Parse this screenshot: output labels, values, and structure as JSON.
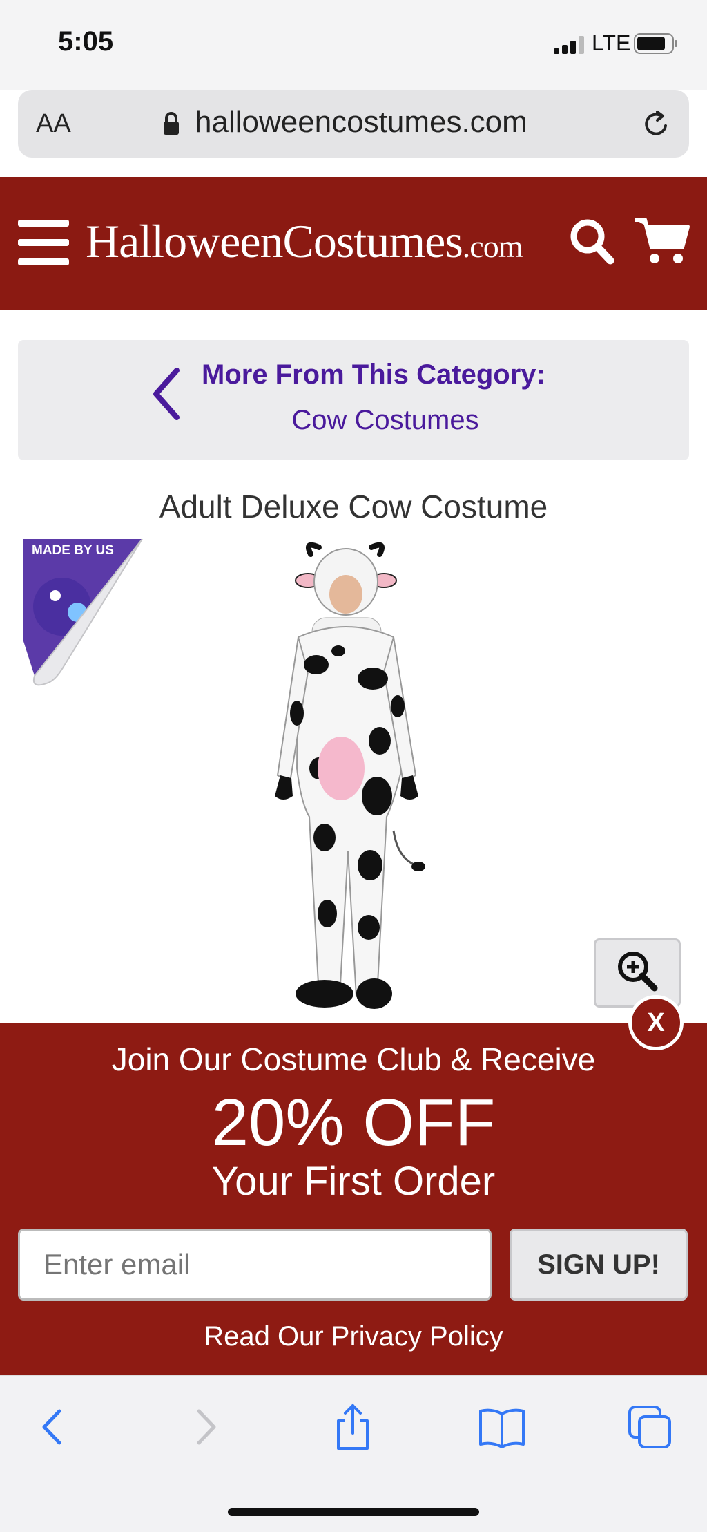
{
  "status_bar": {
    "time": "5:05",
    "network": "LTE"
  },
  "browser": {
    "text_size_label": "AA",
    "url": "halloweencostumes.com"
  },
  "header": {
    "logo_text": "HalloweenCostumes",
    "logo_suffix": ".com"
  },
  "category": {
    "heading": "More From This Category:",
    "link": "Cow Costumes"
  },
  "product": {
    "title": "Adult Deluxe Cow Costume",
    "badge_text": "MADE BY US"
  },
  "promo": {
    "line1": "Join Our Costume Club & Receive",
    "discount": "20% OFF",
    "line3": "Your First Order",
    "email_placeholder": "Enter email",
    "signup_label": "SIGN UP!",
    "privacy_link": "Read Our Privacy Policy",
    "close_label": "X"
  },
  "colors": {
    "brand": "#8b1a12",
    "link": "#4a1a9c",
    "ios_blue": "#3478f6"
  }
}
